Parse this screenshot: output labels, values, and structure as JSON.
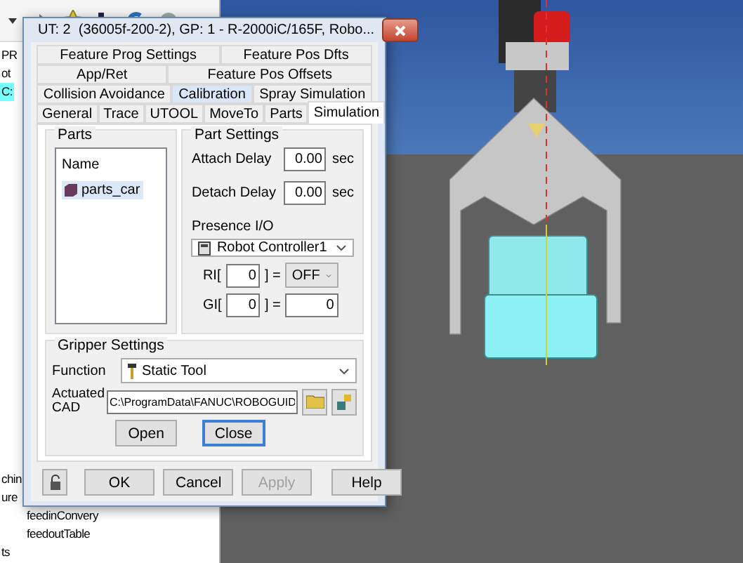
{
  "tree": {
    "top_items": [
      {
        "label": "PR",
        "selected": false
      },
      {
        "label": "ot",
        "selected": false
      },
      {
        "label": "C:",
        "selected": true
      }
    ],
    "bottom_items": [
      {
        "label": "chin",
        "selected": false
      },
      {
        "label": "ure",
        "selected": false
      },
      {
        "label": "feedinConvery",
        "selected": false
      },
      {
        "label": "feedoutTable",
        "selected": false
      },
      {
        "label": "ts",
        "selected": false
      }
    ]
  },
  "dialog": {
    "title": "UT: 2  (36005f-200-2), GP: 1 - R-2000iC/165F, Robo...",
    "tab_rows": [
      [
        {
          "label": "Feature Prog Settings",
          "selected": false,
          "highlighted": false
        },
        {
          "label": "Feature Pos Dfts",
          "selected": false,
          "highlighted": false
        }
      ],
      [
        {
          "label": "App/Ret",
          "selected": false,
          "highlighted": false
        },
        {
          "label": "Feature Pos Offsets",
          "selected": false,
          "highlighted": false
        }
      ],
      [
        {
          "label": "Collision Avoidance",
          "selected": false,
          "highlighted": false
        },
        {
          "label": "Calibration",
          "selected": false,
          "highlighted": true
        },
        {
          "label": "Spray Simulation",
          "selected": false,
          "highlighted": false
        }
      ],
      [
        {
          "label": "General",
          "selected": false,
          "highlighted": false
        },
        {
          "label": "Trace",
          "selected": false,
          "highlighted": false
        },
        {
          "label": "UTOOL",
          "selected": false,
          "highlighted": false
        },
        {
          "label": "MoveTo",
          "selected": false,
          "highlighted": false
        },
        {
          "label": "Parts",
          "selected": false,
          "highlighted": false
        },
        {
          "label": "Simulation",
          "selected": true,
          "highlighted": false
        }
      ]
    ],
    "parts": {
      "title": "Parts",
      "column": "Name",
      "items": [
        {
          "name": "parts_car",
          "selected": true
        }
      ]
    },
    "part_settings": {
      "title": "Part Settings",
      "delays": [
        {
          "label": "Attach Delay",
          "value": "0.00",
          "unit": "sec"
        },
        {
          "label": "Detach Delay",
          "value": "0.00",
          "unit": "sec"
        }
      ],
      "presence_label": "Presence I/O",
      "device": "Robot Controller1",
      "io_rows": [
        {
          "kind": "select",
          "label": "RI[",
          "index": "0",
          "close": "] =",
          "value": "OFF"
        },
        {
          "kind": "field",
          "label": "GI[",
          "index": "0",
          "close": "] =",
          "value": "0"
        }
      ]
    },
    "gripper": {
      "title": "Gripper Settings",
      "function_label": "Function",
      "function_value": "Static Tool",
      "cad_label": "Actuated CAD",
      "cad_path": "C:\\ProgramData\\FANUC\\ROBOGUID",
      "buttons": [
        {
          "label": "Open",
          "focused": false
        },
        {
          "label": "Close",
          "focused": true
        }
      ]
    },
    "buttons": [
      {
        "label": "OK",
        "disabled": false
      },
      {
        "label": "Cancel",
        "disabled": false
      },
      {
        "label": "Apply",
        "disabled": true
      },
      {
        "label": "Help",
        "disabled": false
      }
    ]
  }
}
